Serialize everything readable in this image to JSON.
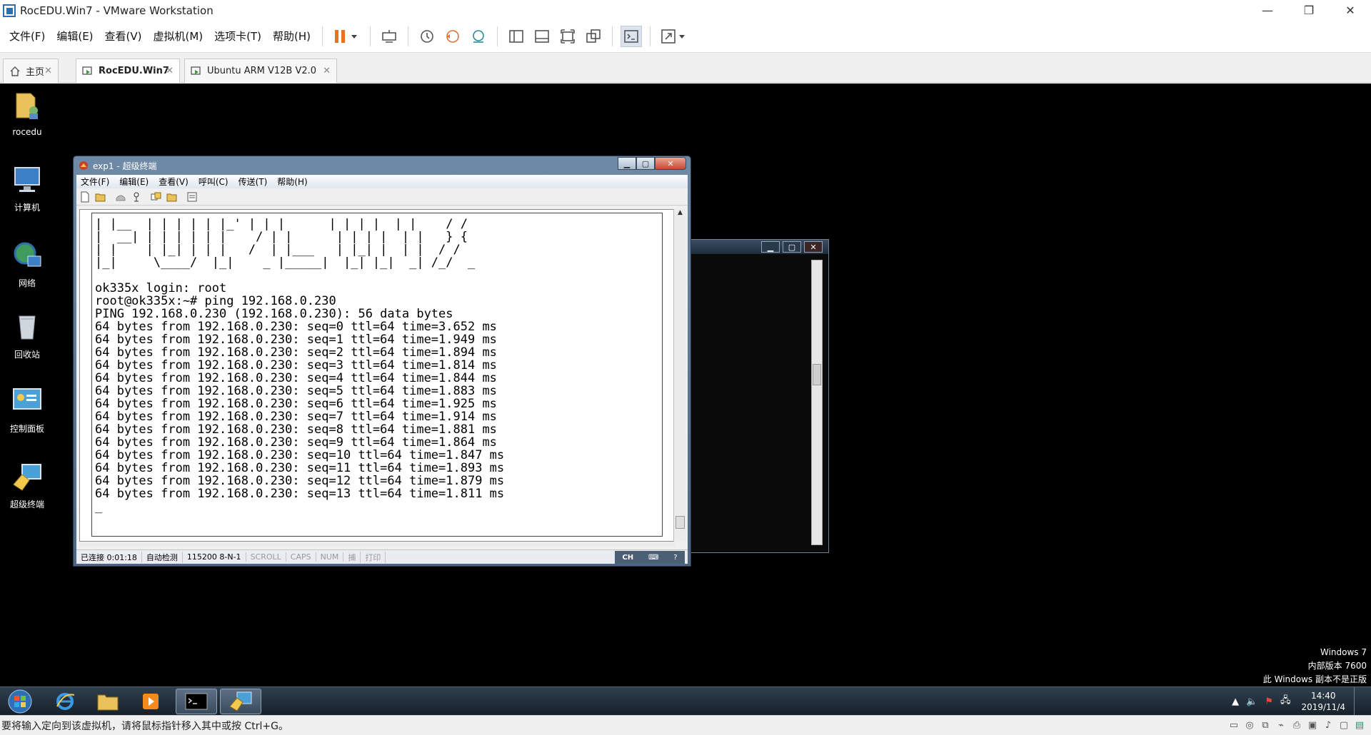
{
  "window": {
    "title": "RocEDU.Win7 - VMware Workstation"
  },
  "menu": {
    "items": [
      "文件(F)",
      "编辑(E)",
      "查看(V)",
      "虚拟机(M)",
      "选项卡(T)",
      "帮助(H)"
    ]
  },
  "tabs": [
    {
      "label": "主页"
    },
    {
      "label": "RocEDU.Win7"
    },
    {
      "label": "Ubuntu ARM V12B V2.0"
    }
  ],
  "desktop": {
    "icons": [
      {
        "label": "rocedu",
        "icon": "user-folder-icon"
      },
      {
        "label": "计算机",
        "icon": "computer-icon"
      },
      {
        "label": "网络",
        "icon": "network-icon"
      },
      {
        "label": "回收站",
        "icon": "recycle-bin-icon"
      },
      {
        "label": "控制面板",
        "icon": "control-panel-icon"
      },
      {
        "label": "超级终端",
        "icon": "hyperterminal-icon"
      }
    ]
  },
  "hyperterminal": {
    "title": "exp1 - 超级终端",
    "menu": [
      "文件(F)",
      "编辑(E)",
      "查看(V)",
      "呼叫(C)",
      "传送(T)",
      "帮助(H)"
    ],
    "lines": [
      "| |__  | | | | | |_' | | |      | | | |  | |    / /",
      "|  __| | | | | | |    / | |      | | | |  | |   } {",
      "| |    | |_| | | |   /  | |___   | |_| |  | |  / /",
      "|_|     \\____/  |_|    _ |_____|  |_| |_|  _| /_/  _",
      "",
      "ok335x login: root",
      "root@ok335x:~# ping 192.168.0.230",
      "PING 192.168.0.230 (192.168.0.230): 56 data bytes",
      "64 bytes from 192.168.0.230: seq=0 ttl=64 time=3.652 ms",
      "64 bytes from 192.168.0.230: seq=1 ttl=64 time=1.949 ms",
      "64 bytes from 192.168.0.230: seq=2 ttl=64 time=1.894 ms",
      "64 bytes from 192.168.0.230: seq=3 ttl=64 time=1.814 ms",
      "64 bytes from 192.168.0.230: seq=4 ttl=64 time=1.844 ms",
      "64 bytes from 192.168.0.230: seq=5 ttl=64 time=1.883 ms",
      "64 bytes from 192.168.0.230: seq=6 ttl=64 time=1.925 ms",
      "64 bytes from 192.168.0.230: seq=7 ttl=64 time=1.914 ms",
      "64 bytes from 192.168.0.230: seq=8 ttl=64 time=1.881 ms",
      "64 bytes from 192.168.0.230: seq=9 ttl=64 time=1.864 ms",
      "64 bytes from 192.168.0.230: seq=10 ttl=64 time=1.847 ms",
      "64 bytes from 192.168.0.230: seq=11 ttl=64 time=1.893 ms",
      "64 bytes from 192.168.0.230: seq=12 ttl=64 time=1.879 ms",
      "64 bytes from 192.168.0.230: seq=13 ttl=64 time=1.811 ms",
      "_"
    ],
    "status": {
      "connected": "已连接 0:01:18",
      "detect": "自动检测",
      "baud": "115200 8-N-1",
      "scroll": "SCROLL",
      "caps": "CAPS",
      "num": "NUM",
      "capture": "捕",
      "print": "打印",
      "ime": "CH"
    }
  },
  "watermark": {
    "line1": "Windows 7",
    "line2": "内部版本 7600",
    "line3": "此 Windows 副本不是正版"
  },
  "taskbar": {
    "time": "14:40",
    "date": "2019/11/4"
  },
  "statusbar": {
    "message": "要将输入定向到该虚拟机，请将鼠标指针移入其中或按 Ctrl+G。"
  },
  "colors": {
    "accent": "#e8731a",
    "guest_bg": "#000000",
    "taskbar": "#1c2733"
  }
}
